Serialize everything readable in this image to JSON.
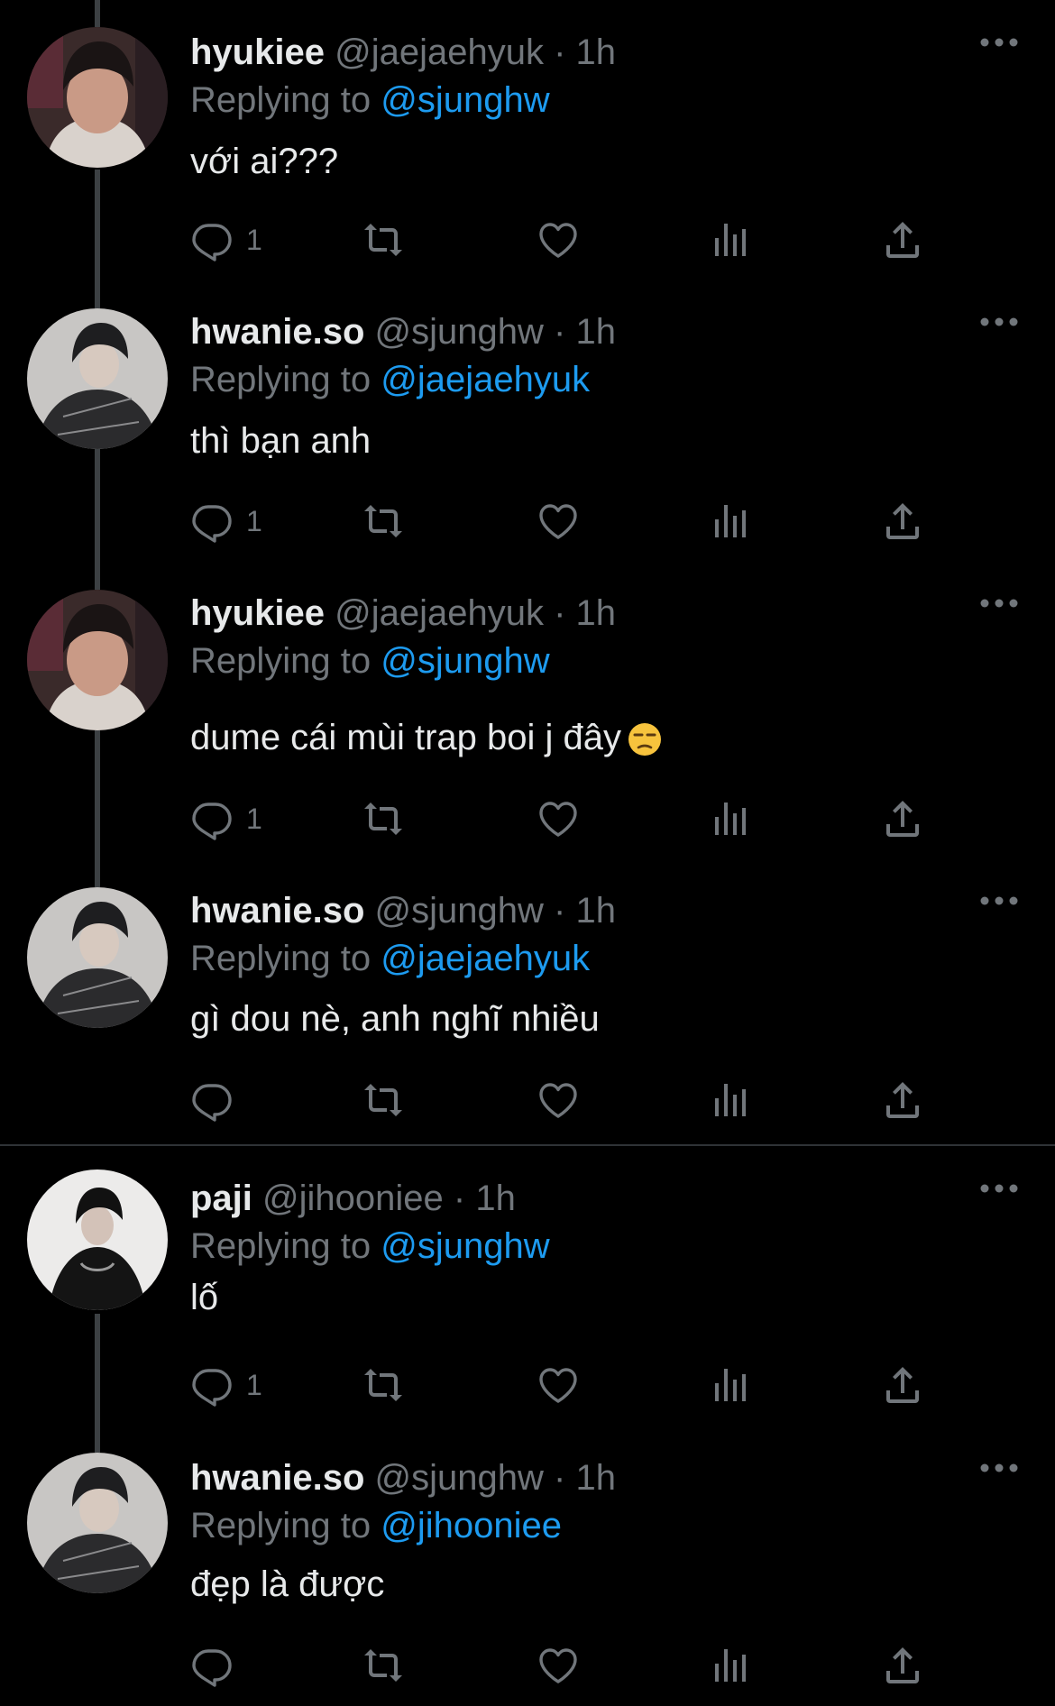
{
  "colors": {
    "background": "#000000",
    "text": "#e7e9ea",
    "muted": "#71767b",
    "accent": "#1d9bf0",
    "thread_line": "#3c4043",
    "divider": "#2f3336"
  },
  "tweets": [
    {
      "name": "hyukiee",
      "handle": "@jaejaehyuk",
      "dot": "·",
      "time": "1h",
      "reply_prefix": "Replying to",
      "reply_to": "@sjunghw",
      "text": "với ai???",
      "reply_count": "1",
      "icons": [
        "reply-icon",
        "retweet-icon",
        "like-icon",
        "views-icon",
        "share-icon",
        "more-icon"
      ]
    },
    {
      "name": "hwanie.so",
      "handle": "@sjunghw",
      "dot": "·",
      "time": "1h",
      "reply_prefix": "Replying to",
      "reply_to": "@jaejaehyuk",
      "text": "thì bạn anh",
      "reply_count": "1"
    },
    {
      "name": "hyukiee",
      "handle": "@jaejaehyuk",
      "dot": "·",
      "time": "1h",
      "reply_prefix": "Replying to",
      "reply_to": "@sjunghw",
      "text": "dume cái mùi trap boi j đây",
      "emoji": "unamused-face-emoji",
      "reply_count": "1"
    },
    {
      "name": "hwanie.so",
      "handle": "@sjunghw",
      "dot": "·",
      "time": "1h",
      "reply_prefix": "Replying to",
      "reply_to": "@jaejaehyuk",
      "text": "gì dou nè, anh nghĩ nhiều",
      "reply_count": ""
    },
    {
      "name": "paji",
      "handle": "@jihooniee",
      "dot": "·",
      "time": "1h",
      "reply_prefix": "Replying to",
      "reply_to": "@sjunghw",
      "text": "lố",
      "reply_count": "1"
    },
    {
      "name": "hwanie.so",
      "handle": "@sjunghw",
      "dot": "·",
      "time": "1h",
      "reply_prefix": "Replying to",
      "reply_to": "@jihooniee",
      "text": "đẹp là được",
      "reply_count": ""
    }
  ]
}
